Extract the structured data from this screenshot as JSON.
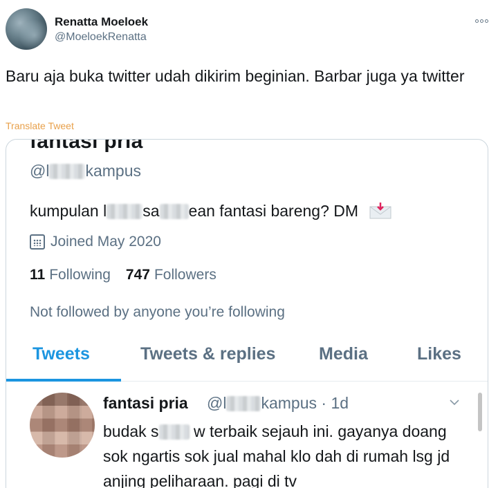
{
  "author": {
    "name": "Renatta Moeloek",
    "handle": "@MoeloekRenatta"
  },
  "tweet": {
    "text": "Baru aja buka twitter udah dikirim beginian. Barbar juga ya twitter",
    "translate_label": "Translate Tweet"
  },
  "embedded_profile": {
    "name": "fantasi pria",
    "handle_prefix": "@l",
    "handle_suffix": "kampus",
    "bio_part1": "kumpulan l",
    "bio_part2": "sa",
    "bio_part3": "ean fantasi bareng? DM",
    "joined": "Joined May 2020",
    "following_count": "11",
    "following_label": "Following",
    "followers_count": "747",
    "followers_label": "Followers",
    "not_followed": "Not followed by anyone you’re following",
    "tabs": [
      "Tweets",
      "Tweets & replies",
      "Media",
      "Likes"
    ],
    "active_tab": "Tweets",
    "accent_color": "#1b95e0"
  },
  "embedded_tweet": {
    "name": "fantasi pria",
    "handle_prefix": "@l",
    "handle_suffix": "kampus",
    "time": "· 1d",
    "text_part1": "budak s",
    "text_part2": " w terbaik sejauh ini. gayanya doang sok ngartis sok jual mahal klo dah di rumah lsg jd anjing peliharaan. pagi di tv"
  },
  "icons": {
    "more": "more-horizontal-icon",
    "calendar": "calendar-icon",
    "envelope": "envelope-icon",
    "chevron": "chevron-down-icon"
  }
}
